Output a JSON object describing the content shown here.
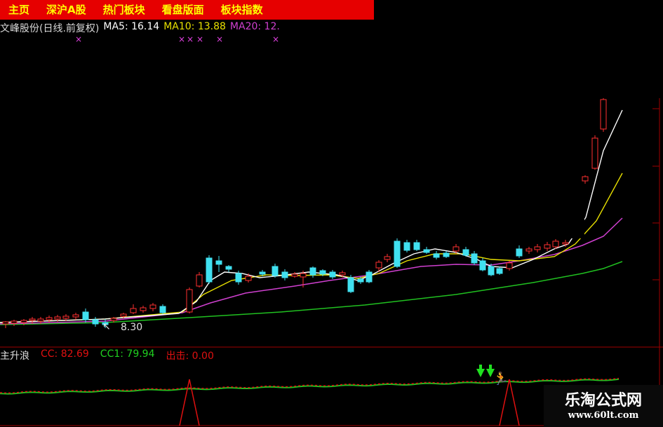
{
  "tabs": [
    "主页",
    "深沪A股",
    "热门板块",
    "看盘版面",
    "板块指数"
  ],
  "info": {
    "title": "文峰股份(日线.前复权)",
    "ma5": "MA5: 16.14",
    "ma10": "MA10: 13.88",
    "ma20": "MA20: 12."
  },
  "chart": {
    "low_label": "8.30"
  },
  "indicator": {
    "name": "主升浪",
    "cc": "CC: 82.69",
    "cc1": "CC1: 79.94",
    "chuji": "出击: 0.00"
  },
  "watermark": {
    "name": "乐淘公式网",
    "url": "www.60lt.com"
  },
  "colors": {
    "up": "#ff3030",
    "down": "#40e0f0",
    "ma5": "#ffffff",
    "ma10": "#e8e000",
    "ma20": "#d040d0",
    "ma60": "#20c020",
    "grid": "#a00000"
  }
}
